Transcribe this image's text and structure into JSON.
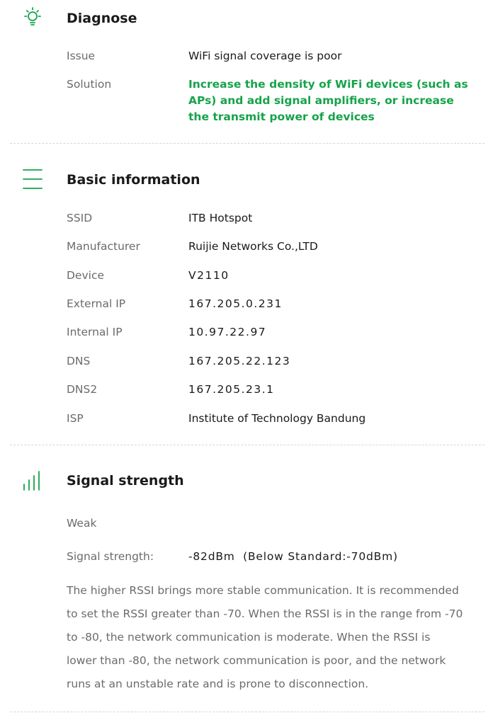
{
  "accent_color": "#16a34a",
  "diagnose": {
    "icon": "lightbulb-icon",
    "title": "Diagnose",
    "issue_label": "Issue",
    "issue_value": "WiFi signal coverage is poor",
    "solution_label": "Solution",
    "solution_value": "Increase the density of WiFi devices (such as APs) and add signal amplifiers, or increase the transmit power of devices"
  },
  "basic_info": {
    "icon": "menu-lines-icon",
    "title": "Basic information",
    "rows": [
      {
        "label": "SSID",
        "value": "ITB Hotspot"
      },
      {
        "label": "Manufacturer",
        "value": "Ruijie Networks Co.,LTD"
      },
      {
        "label": "Device",
        "value": "V2110"
      },
      {
        "label": "External IP",
        "value": "167.205.0.231"
      },
      {
        "label": "Internal IP",
        "value": "10.97.22.97"
      },
      {
        "label": "DNS",
        "value": "167.205.22.123"
      },
      {
        "label": "DNS2",
        "value": "167.205.23.1"
      },
      {
        "label": "ISP",
        "value": "Institute of Technology Bandung"
      }
    ]
  },
  "signal": {
    "icon": "signal-bars-icon",
    "title": "Signal strength",
    "level": "Weak",
    "strength_label": "Signal strength:",
    "strength_value": "-82dBm  (Below Standard:-70dBm)",
    "description": "The higher RSSI brings more stable communication. It is recommended to set the RSSI greater than -70. When the RSSI is in the range from -70 to -80, the network communication is moderate. When the RSSI is lower than -80, the network communication is poor, and the network runs at an unstable rate and is prone to disconnection."
  }
}
